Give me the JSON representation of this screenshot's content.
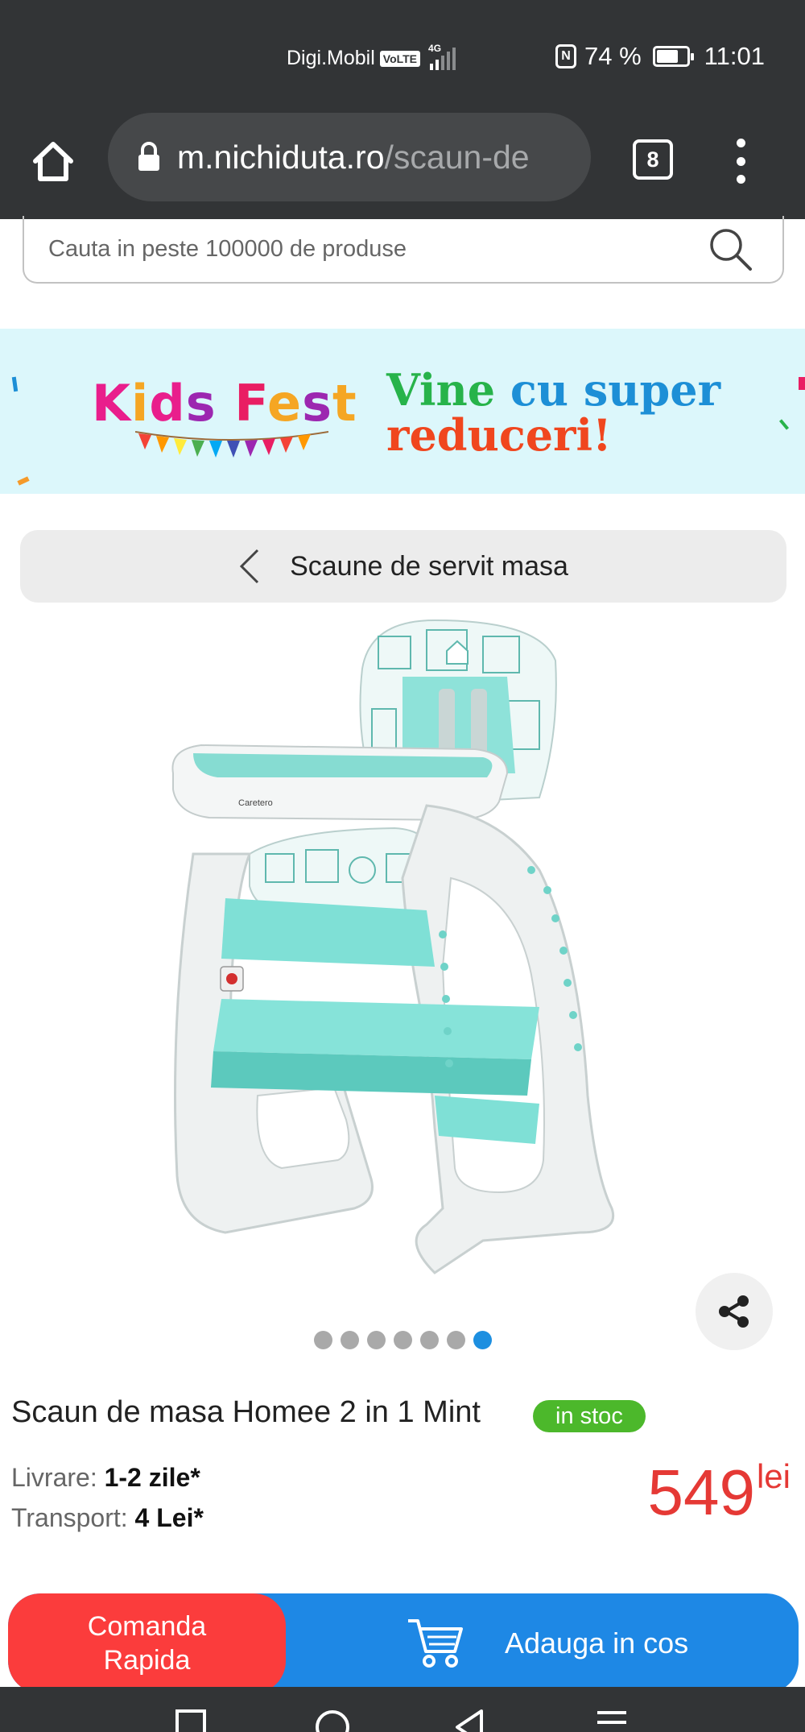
{
  "status_bar": {
    "carrier": "Digi.Mobil",
    "volte": "VoLTE",
    "network": "4G",
    "battery_percent": "74 %",
    "battery_level": 0.74,
    "time": "11:01"
  },
  "browser": {
    "url_host": "m.nichiduta.ro",
    "url_path": "/scaun-de",
    "tab_count": "8"
  },
  "search": {
    "placeholder": "Cauta in peste 100000 de produse"
  },
  "banner": {
    "title": "Kids Fest",
    "tagline_line1_a": "Vine",
    "tagline_line1_b": "cu super",
    "tagline_line2": "reduceri!"
  },
  "breadcrumb": {
    "label": "Scaune de servit masa"
  },
  "gallery": {
    "slide_count": 7,
    "active_index": 6
  },
  "product": {
    "title": "Scaun de masa Homee 2 in 1 Mint",
    "stock": "in stoc",
    "delivery_label": "Livrare:",
    "delivery_value": "1-2 zile*",
    "transport_label": "Transport:",
    "transport_value": "4 Lei*",
    "price": "549",
    "currency": "lei",
    "brand_on_image": "Caretero"
  },
  "actions": {
    "quick_order_line1": "Comanda",
    "quick_order_line2": "Rapida",
    "add_to_cart": "Adauga in cos"
  },
  "colors": {
    "chrome": "#323436",
    "stock_green": "#4cb82b",
    "price_red": "#e53935",
    "quick_red": "#fb3c3c",
    "cart_blue": "#1e88e5",
    "mint": "#7fe0d6"
  }
}
